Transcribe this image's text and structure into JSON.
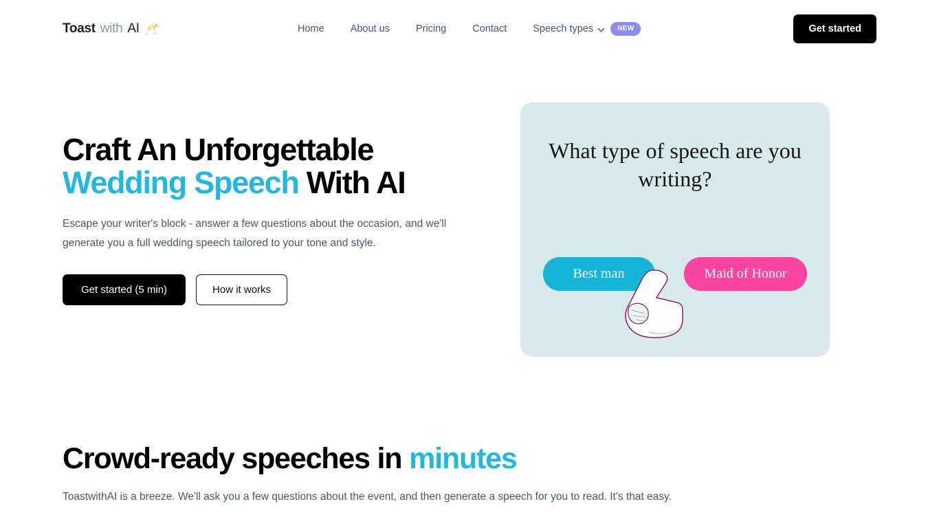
{
  "brand": {
    "name_part1": "Toast",
    "name_part2": "with",
    "name_part3": "AI",
    "emoji": "🥂"
  },
  "nav": {
    "items": [
      {
        "label": "Home",
        "has_chevron": false,
        "badge": null
      },
      {
        "label": "About us",
        "has_chevron": false,
        "badge": null
      },
      {
        "label": "Pricing",
        "has_chevron": false,
        "badge": null
      },
      {
        "label": "Contact",
        "has_chevron": false,
        "badge": null
      },
      {
        "label": "Speech types",
        "has_chevron": true,
        "badge": "NEW"
      }
    ],
    "badge_label": "NEW",
    "cta_label": "Get started"
  },
  "hero": {
    "title_line1": "Craft An Unforgettable",
    "title_line2_accent": "Wedding Speech",
    "title_line2_rest": " With AI",
    "subtitle": "Escape your writer's block - answer a few questions about the occasion, and we'll generate you a full wedding speech tailored to your tone and style.",
    "primary_cta": "Get started (5 min)",
    "secondary_cta": "How it works"
  },
  "hero_card": {
    "question": "What type of speech are you writing?",
    "option_left": "Best man",
    "option_right": "Maid of Honor"
  },
  "section": {
    "title_main": "Crowd-ready speeches in ",
    "title_accent": "minutes",
    "subtitle": "ToastwithAI is a breeze. We'll ask you a few questions about the event, and then generate a speech for you to read. It's that easy."
  },
  "colors": {
    "accent_cyan": "#22b8de",
    "pill_cyan": "#16b4d8",
    "pill_pink": "#fa45a0",
    "badge_purple": "#8b8cf0",
    "card_bg": "#d8e9e9",
    "black": "#000000"
  }
}
